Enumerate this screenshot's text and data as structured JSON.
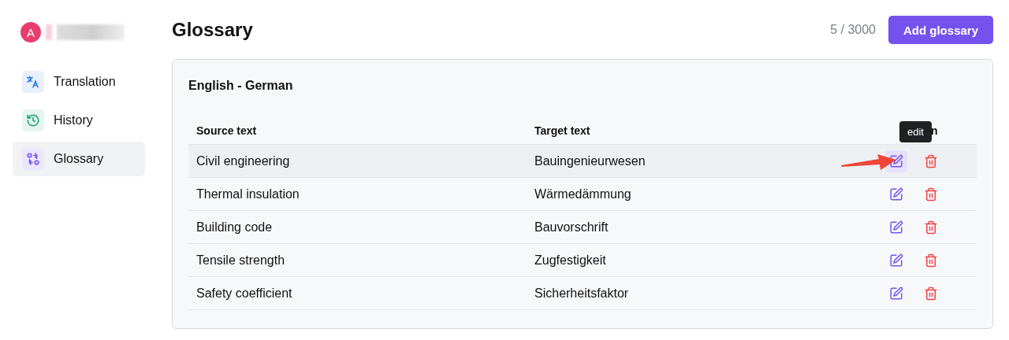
{
  "user": {
    "avatar_letter": "A"
  },
  "sidebar": {
    "items": [
      {
        "label": "Translation",
        "kind": "translate",
        "selected": false
      },
      {
        "label": "History",
        "kind": "history",
        "selected": false
      },
      {
        "label": "Glossary",
        "kind": "swap",
        "selected": true
      }
    ]
  },
  "header": {
    "title": "Glossary",
    "count": "5 / 3000",
    "add_button": "Add glossary"
  },
  "glossary": {
    "title": "English - German",
    "columns": [
      "Source text",
      "Target text",
      "n"
    ],
    "rows": [
      {
        "source": "Civil engineering",
        "target": "Bauingenieurwesen",
        "hovered": true
      },
      {
        "source": "Thermal insulation",
        "target": "Wärmedämmung",
        "hovered": false
      },
      {
        "source": "Building code",
        "target": "Bauvorschrift",
        "hovered": false
      },
      {
        "source": "Tensile strength",
        "target": "Zugfestigkeit",
        "hovered": false
      },
      {
        "source": "Safety coefficient",
        "target": "Sicherheitsfaktor",
        "hovered": false
      }
    ],
    "tooltip": "edit"
  }
}
